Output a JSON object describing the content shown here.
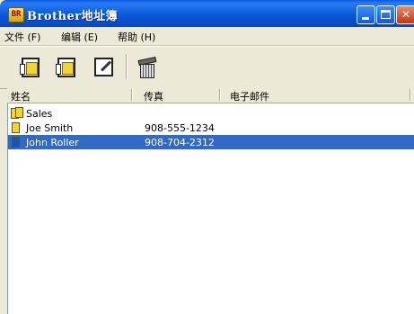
{
  "window": {
    "title": "Brother地址簿",
    "app_icon_text": "BR",
    "controls": {
      "minimize": "minimize",
      "maximize": "maximize",
      "close": "✕"
    }
  },
  "menu": {
    "items": [
      "文件 (F)",
      "编辑 (E)",
      "帮助 (H)"
    ]
  },
  "toolbar": {
    "buttons": [
      "new-contact-icon",
      "new-group-icon",
      "edit-icon",
      "delete-icon"
    ]
  },
  "list": {
    "columns": [
      "姓名",
      "传真",
      "电子邮件"
    ],
    "rows": [
      {
        "name": "Sales",
        "fax": "",
        "email": "",
        "type": "group",
        "selected": false
      },
      {
        "name": "Joe Smith",
        "fax": "908-555-1234",
        "email": "",
        "type": "contact",
        "selected": false
      },
      {
        "name": "John Roller",
        "fax": "908-704-2312",
        "email": "",
        "type": "contact",
        "selected": true
      }
    ]
  },
  "colors": {
    "title_bar": "#0A58D6",
    "selection": "#316AC5",
    "face": "#ECE9D8"
  }
}
